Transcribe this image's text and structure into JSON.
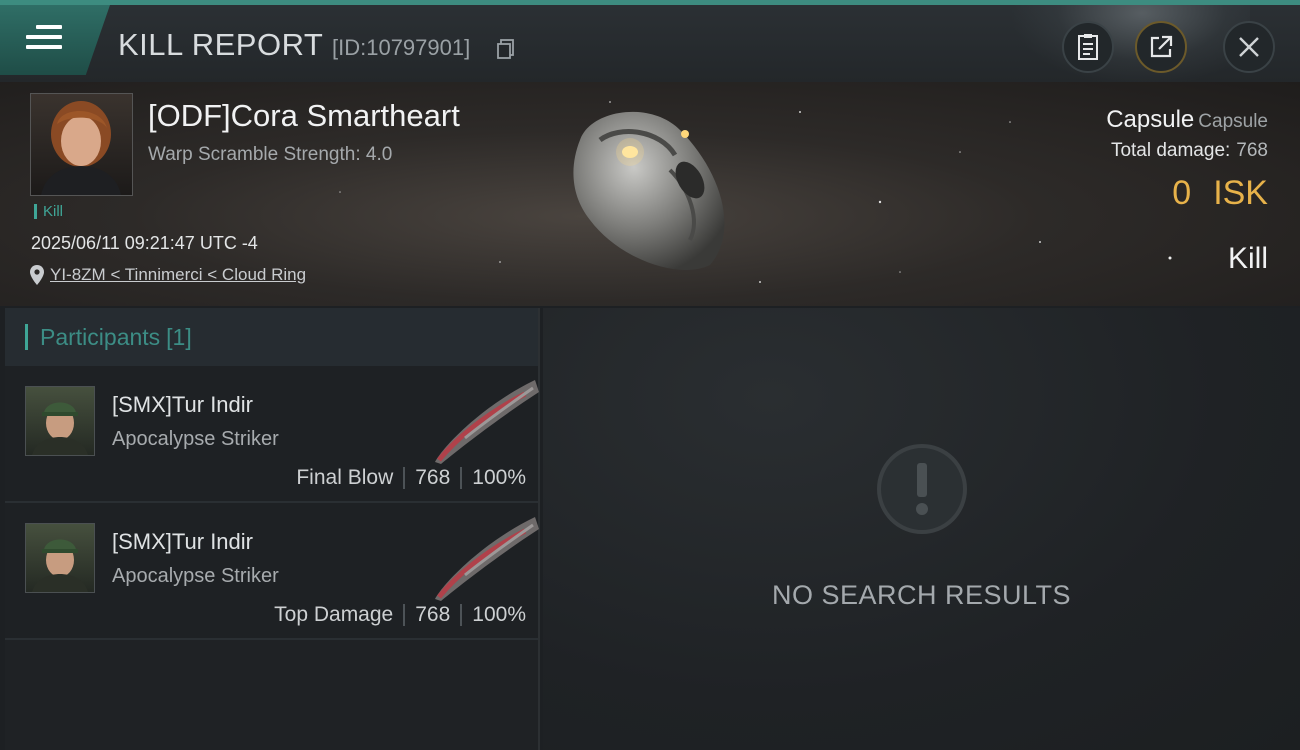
{
  "header": {
    "title": "KILL REPORT",
    "report_id": "[ID:10797901]",
    "icons": {
      "menu": "hamburger-menu-icon",
      "copy": "copy-icon",
      "report": "clipboard-icon",
      "share": "share-icon",
      "close": "close-icon"
    }
  },
  "victim": {
    "name": "[ODF]Cora Smartheart",
    "warp_scramble": "Warp Scramble Strength: 4.0",
    "tag": "Kill",
    "datetime": "2025/06/11 09:21:47 UTC -4",
    "location": "YI-8ZM < Tinnimerci < Cloud Ring",
    "ship_type": "Capsule",
    "ship_type_sub": "Capsule",
    "total_damage_label": "Total damage:",
    "total_damage": "768",
    "isk_value": "0",
    "isk_unit": "ISK",
    "result": "Kill"
  },
  "participants": {
    "label": "Participants",
    "count": "[1]",
    "rows": [
      {
        "name": "[SMX]Tur Indir",
        "ship": "Apocalypse Striker",
        "role": "Final Blow",
        "damage": "768",
        "percent": "100%"
      },
      {
        "name": "[SMX]Tur Indir",
        "ship": "Apocalypse Striker",
        "role": "Top Damage",
        "damage": "768",
        "percent": "100%"
      }
    ]
  },
  "results_panel": {
    "empty_text": "NO SEARCH RESULTS",
    "icon": "exclamation-icon"
  },
  "colors": {
    "accent_teal": "#3fa697",
    "isk_gold": "#e7b24a",
    "header_bar": "#3d8c80"
  }
}
